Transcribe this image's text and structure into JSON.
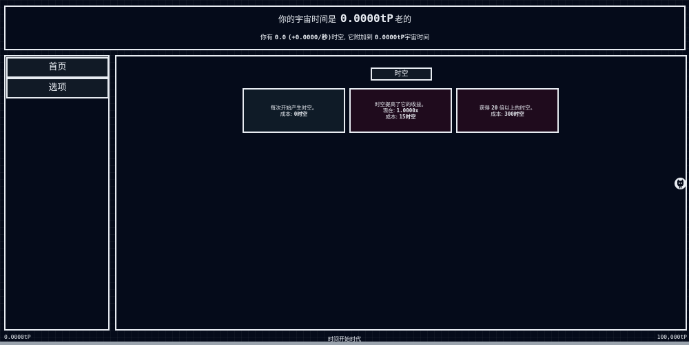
{
  "header": {
    "prefix": "你的宇宙时间是",
    "universe_time": "0.0000tP",
    "suffix": "老的",
    "line2_prefix": "你有",
    "spacetime_amount": "0.0",
    "spacetime_rate": "(+0.0000/秒)",
    "line2_middle": "时空, 它附加到",
    "bonus_time": "0.0000tP",
    "line2_suffix": "宇宙时间"
  },
  "sidebar": {
    "items": [
      {
        "label": "首页"
      },
      {
        "label": "选项"
      }
    ]
  },
  "main": {
    "section_tab": "时空",
    "cards": [
      {
        "line1": "每次开始产生时空。",
        "cost_label": "成本:",
        "cost_value": "0时空",
        "state": "affordable"
      },
      {
        "line1": "时空提高了它的收益。",
        "current_label": "现在:",
        "current_value": "1.0000x",
        "cost_label": "成本:",
        "cost_value": "15时空",
        "state": "locked"
      },
      {
        "line1_prefix": "获得",
        "line1_number": "20",
        "line1_suffix": "倍以上的时空。",
        "cost_label": "成本:",
        "cost_value": "300时空",
        "state": "locked"
      }
    ]
  },
  "footer": {
    "left": "0.0000tP",
    "center": "时间开始时代",
    "right": "100,000tP",
    "progress": 0.0
  },
  "icons": {
    "side_icon": "github-cat-icon"
  },
  "colors": {
    "background": "#050b1a",
    "border": "#e8ecf2",
    "card_affordable": "#0f1b27",
    "card_locked": "#1f0b1d"
  }
}
